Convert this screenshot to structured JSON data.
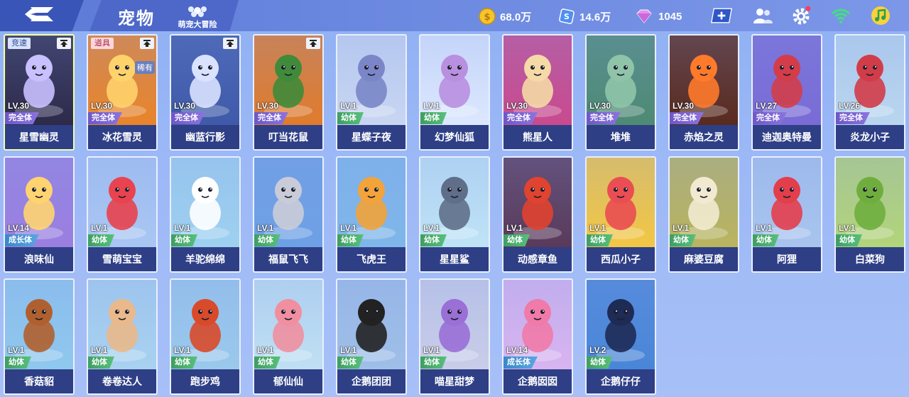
{
  "header": {
    "title": "宠物",
    "game_name": "萌宠大冒险",
    "coins": "68.0万",
    "tickets": "14.6万",
    "diamonds": "1045"
  },
  "colors": {
    "header_bg": "#5b79d6",
    "name_bar": "#2e3f86",
    "stage_full": "#6f57c9",
    "stage_baby": "#3f9e62",
    "stage_grow": "#3a88c9"
  },
  "icons": [
    "back-icon",
    "coin-icon",
    "ticket-icon",
    "diamond-icon",
    "add-icon",
    "friends-icon",
    "settings-icon",
    "wifi-icon",
    "music-icon",
    "pin-icon"
  ],
  "pets": [
    {
      "name": "星雪幽灵",
      "level": "LV.30",
      "stage": "完全体",
      "stage_type": "full",
      "tag": "竞速",
      "tag_type": "speed",
      "pinned": true,
      "rare": "",
      "theme": "#2d2a4a",
      "accent": "#c9c0ff",
      "selected": true
    },
    {
      "name": "冰花雪灵",
      "level": "LV.30",
      "stage": "完全体",
      "stage_type": "full",
      "tag": "道具",
      "tag_type": "item",
      "pinned": true,
      "rare": "稀有",
      "theme": "#e9842a",
      "accent": "#ffd36b",
      "selected": false
    },
    {
      "name": "幽蓝行影",
      "level": "LV.30",
      "stage": "完全体",
      "stage_type": "full",
      "tag": "",
      "tag_type": "",
      "pinned": true,
      "rare": "",
      "theme": "#3e5aa8",
      "accent": "#d9e2ff",
      "selected": false
    },
    {
      "name": "叮当花鼠",
      "level": "LV.30",
      "stage": "完全体",
      "stage_type": "full",
      "tag": "",
      "tag_type": "",
      "pinned": true,
      "rare": "",
      "theme": "#e07b2c",
      "accent": "#3f8b3a",
      "selected": false
    },
    {
      "name": "星蝶子夜",
      "level": "LV.1",
      "stage": "幼体",
      "stage_type": "baby",
      "tag": "",
      "tag_type": "",
      "pinned": false,
      "rare": "",
      "theme": "#c8d6f2",
      "accent": "#7a86c8",
      "selected": false
    },
    {
      "name": "幻梦仙狐",
      "level": "LV.1",
      "stage": "幼体",
      "stage_type": "baby",
      "tag": "",
      "tag_type": "",
      "pinned": false,
      "rare": "",
      "theme": "#dce8ff",
      "accent": "#b98fe0",
      "selected": false
    },
    {
      "name": "熊星人",
      "level": "LV.30",
      "stage": "完全体",
      "stage_type": "full",
      "tag": "",
      "tag_type": "",
      "pinned": false,
      "rare": "",
      "theme": "#c94a8e",
      "accent": "#f5d9a6",
      "selected": false
    },
    {
      "name": "堆堆",
      "level": "LV.30",
      "stage": "完全体",
      "stage_type": "full",
      "tag": "",
      "tag_type": "",
      "pinned": false,
      "rare": "",
      "theme": "#4e8a74",
      "accent": "#8fc4a8",
      "selected": false
    },
    {
      "name": "赤焰之灵",
      "level": "LV.30",
      "stage": "完全体",
      "stage_type": "full",
      "tag": "",
      "tag_type": "",
      "pinned": false,
      "rare": "",
      "theme": "#5a2a1e",
      "accent": "#ff7a2a",
      "selected": false
    },
    {
      "name": "迪迦奥特曼",
      "level": "LV.27",
      "stage": "完全体",
      "stage_type": "full",
      "tag": "",
      "tag_type": "",
      "pinned": false,
      "rare": "",
      "theme": "#7a6bd6",
      "accent": "#d33d4a",
      "selected": false
    },
    {
      "name": "炎龙小子",
      "level": "LV.26",
      "stage": "完全体",
      "stage_type": "full",
      "tag": "",
      "tag_type": "",
      "pinned": false,
      "rare": "",
      "theme": "#b9d6ef",
      "accent": "#d23c48",
      "selected": false
    },
    {
      "name": "浪味仙",
      "level": "LV.14",
      "stage": "成长体",
      "stage_type": "grow",
      "tag": "",
      "tag_type": "",
      "pinned": false,
      "rare": "",
      "theme": "#9a7fe0",
      "accent": "#ffd470",
      "selected": false
    },
    {
      "name": "雪萌宝宝",
      "level": "LV.1",
      "stage": "幼体",
      "stage_type": "baby",
      "tag": "",
      "tag_type": "",
      "pinned": false,
      "rare": "",
      "theme": "#a9c6f3",
      "accent": "#e8434f",
      "selected": false
    },
    {
      "name": "羊驼绵绵",
      "level": "LV.1",
      "stage": "幼体",
      "stage_type": "baby",
      "tag": "",
      "tag_type": "",
      "pinned": false,
      "rare": "",
      "theme": "#9ed1f0",
      "accent": "#ffffff",
      "selected": false
    },
    {
      "name": "福鼠飞飞",
      "level": "LV.1",
      "stage": "幼体",
      "stage_type": "baby",
      "tag": "",
      "tag_type": "",
      "pinned": false,
      "rare": "",
      "theme": "#6ea0e6",
      "accent": "#c9ccd8",
      "selected": false
    },
    {
      "name": "飞虎王",
      "level": "LV.1",
      "stage": "幼体",
      "stage_type": "baby",
      "tag": "",
      "tag_type": "",
      "pinned": false,
      "rare": "",
      "theme": "#7fb7ea",
      "accent": "#f2a33a",
      "selected": false
    },
    {
      "name": "星星鲨",
      "level": "LV.1",
      "stage": "幼体",
      "stage_type": "baby",
      "tag": "",
      "tag_type": "",
      "pinned": false,
      "rare": "",
      "theme": "#bfe3f6",
      "accent": "#5f6f8a",
      "selected": false
    },
    {
      "name": "动感章鱼",
      "level": "LV.1",
      "stage": "幼体",
      "stage_type": "baby",
      "tag": "",
      "tag_type": "",
      "pinned": false,
      "rare": "",
      "theme": "#5a3a5a",
      "accent": "#e0432f",
      "selected": false
    },
    {
      "name": "西瓜小子",
      "level": "LV.1",
      "stage": "幼体",
      "stage_type": "baby",
      "tag": "",
      "tag_type": "",
      "pinned": false,
      "rare": "",
      "theme": "#f3c744",
      "accent": "#ea4d52",
      "selected": false
    },
    {
      "name": "麻婆豆腐",
      "level": "LV.1",
      "stage": "幼体",
      "stage_type": "baby",
      "tag": "",
      "tag_type": "",
      "pinned": false,
      "rare": "",
      "theme": "#b9b45e",
      "accent": "#f2ead0",
      "selected": false
    },
    {
      "name": "阿狸",
      "level": "LV.1",
      "stage": "幼体",
      "stage_type": "baby",
      "tag": "",
      "tag_type": "",
      "pinned": false,
      "rare": "",
      "theme": "#a8c4ee",
      "accent": "#e33e4c",
      "selected": false
    },
    {
      "name": "白菜狗",
      "level": "LV.1",
      "stage": "幼体",
      "stage_type": "baby",
      "tag": "",
      "tag_type": "",
      "pinned": false,
      "rare": "",
      "theme": "#b3d47a",
      "accent": "#6fae3e",
      "selected": false
    },
    {
      "name": "香菇貂",
      "level": "LV.1",
      "stage": "幼体",
      "stage_type": "baby",
      "tag": "",
      "tag_type": "",
      "pinned": false,
      "rare": "",
      "theme": "#8fc8ee",
      "accent": "#b0602e",
      "selected": false
    },
    {
      "name": "卷卷达人",
      "level": "LV.1",
      "stage": "幼体",
      "stage_type": "baby",
      "tag": "",
      "tag_type": "",
      "pinned": false,
      "rare": "",
      "theme": "#a8d2f0",
      "accent": "#e9b98b",
      "selected": false
    },
    {
      "name": "跑步鸡",
      "level": "LV.1",
      "stage": "幼体",
      "stage_type": "baby",
      "tag": "",
      "tag_type": "",
      "pinned": false,
      "rare": "",
      "theme": "#9ac9ec",
      "accent": "#d84a2a",
      "selected": false
    },
    {
      "name": "郁仙仙",
      "level": "LV.1",
      "stage": "幼体",
      "stage_type": "baby",
      "tag": "",
      "tag_type": "",
      "pinned": false,
      "rare": "",
      "theme": "#bfe0f3",
      "accent": "#f08fa0",
      "selected": false
    },
    {
      "name": "企鹅团团",
      "level": "LV.1",
      "stage": "幼体",
      "stage_type": "baby",
      "tag": "",
      "tag_type": "",
      "pinned": false,
      "rare": "",
      "theme": "#9fbfe8",
      "accent": "#222222",
      "selected": false
    },
    {
      "name": "喵星甜梦",
      "level": "LV.1",
      "stage": "幼体",
      "stage_type": "baby",
      "tag": "",
      "tag_type": "",
      "pinned": false,
      "rare": "",
      "theme": "#c9cde8",
      "accent": "#9a6fd6",
      "selected": false
    },
    {
      "name": "企鹅囡囡",
      "level": "LV.14",
      "stage": "成长体",
      "stage_type": "grow",
      "tag": "",
      "tag_type": "",
      "pinned": false,
      "rare": "",
      "theme": "#d8b4f0",
      "accent": "#f07aa8",
      "selected": false
    },
    {
      "name": "企鹅仔仔",
      "level": "LV.2",
      "stage": "幼体",
      "stage_type": "baby",
      "tag": "",
      "tag_type": "",
      "pinned": false,
      "rare": "",
      "theme": "#4a86d8",
      "accent": "#1e2b55",
      "selected": false
    }
  ]
}
